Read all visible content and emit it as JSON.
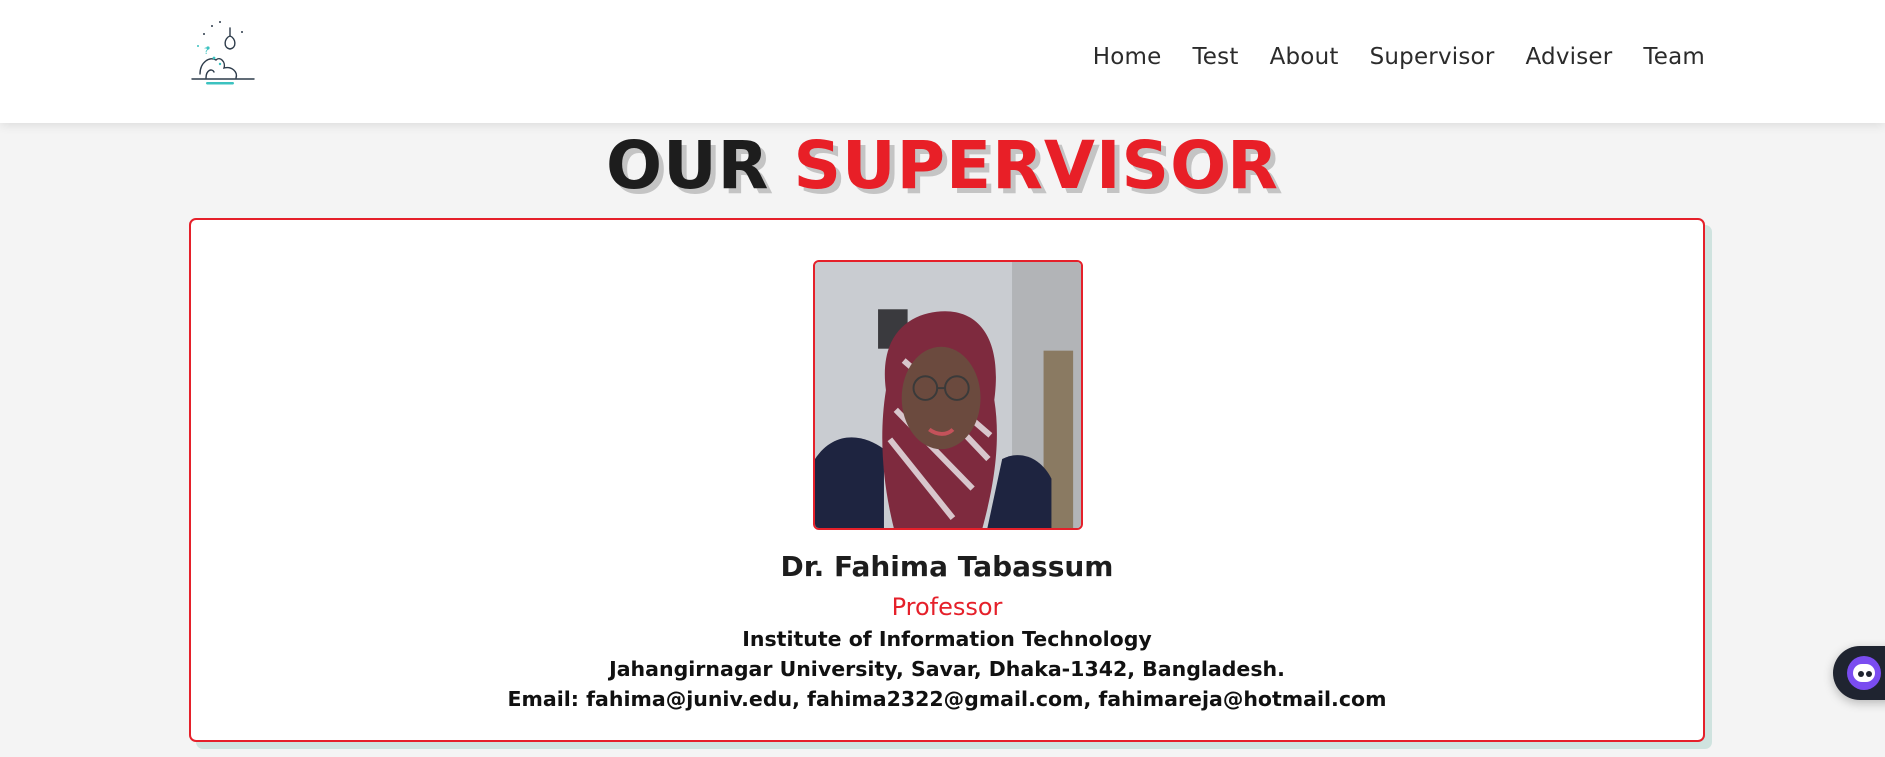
{
  "nav": {
    "logo_icon": "lightbulb-thinking-person-logo",
    "links": [
      "Home",
      "Test",
      "About",
      "Supervisor",
      "Adviser",
      "Team"
    ]
  },
  "section": {
    "title_part1": "OUR",
    "title_part2": "SUPERVISOR"
  },
  "supervisor": {
    "name": "Dr. Fahima Tabassum",
    "role": "Professor",
    "institute": "Institute of Information Technology",
    "address": "Jahangirnagar University, Savar, Dhaka-1342, Bangladesh.",
    "email_line": "Email: fahima@juniv.edu, fahima2322@gmail.com, fahimareja@hotmail.com",
    "photo": "supervisor-portrait-photo"
  },
  "chat_widget": {
    "icon": "chat-bot-icon"
  },
  "colors": {
    "accent": "#e5202a",
    "title_dark": "#1d1d1d",
    "background": "#f4f4f4",
    "card_shadow": "#cfe3df"
  }
}
